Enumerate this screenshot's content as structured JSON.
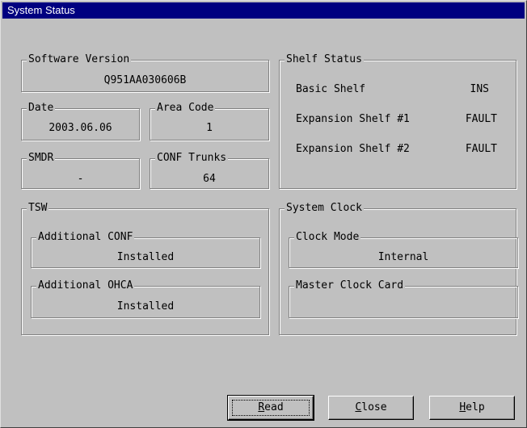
{
  "window": {
    "title": "System Status"
  },
  "software_version": {
    "label": "Software Version",
    "value": "Q951AA030606B"
  },
  "date": {
    "label": "Date",
    "value": "2003.06.06"
  },
  "area_code": {
    "label": "Area Code",
    "value": "1"
  },
  "smdr": {
    "label": "SMDR",
    "value": "-"
  },
  "conf_trunks": {
    "label": "CONF Trunks",
    "value": "64"
  },
  "shelf_status": {
    "label": "Shelf Status",
    "rows": [
      {
        "name": "Basic Shelf",
        "state": "INS"
      },
      {
        "name": "Expansion Shelf #1",
        "state": "FAULT"
      },
      {
        "name": "Expansion Shelf #2",
        "state": "FAULT"
      }
    ]
  },
  "tsw": {
    "label": "TSW",
    "additional_conf": {
      "label": "Additional CONF",
      "value": "Installed"
    },
    "additional_ohca": {
      "label": "Additional OHCA",
      "value": "Installed"
    }
  },
  "system_clock": {
    "label": "System Clock",
    "clock_mode": {
      "label": "Clock Mode",
      "value": "Internal"
    },
    "master_clock_card": {
      "label": "Master Clock Card",
      "value": ""
    }
  },
  "buttons": {
    "read": {
      "first": "R",
      "rest": "ead"
    },
    "close": {
      "first": "C",
      "rest": "lose"
    },
    "help": {
      "first": "H",
      "rest": "elp"
    }
  }
}
